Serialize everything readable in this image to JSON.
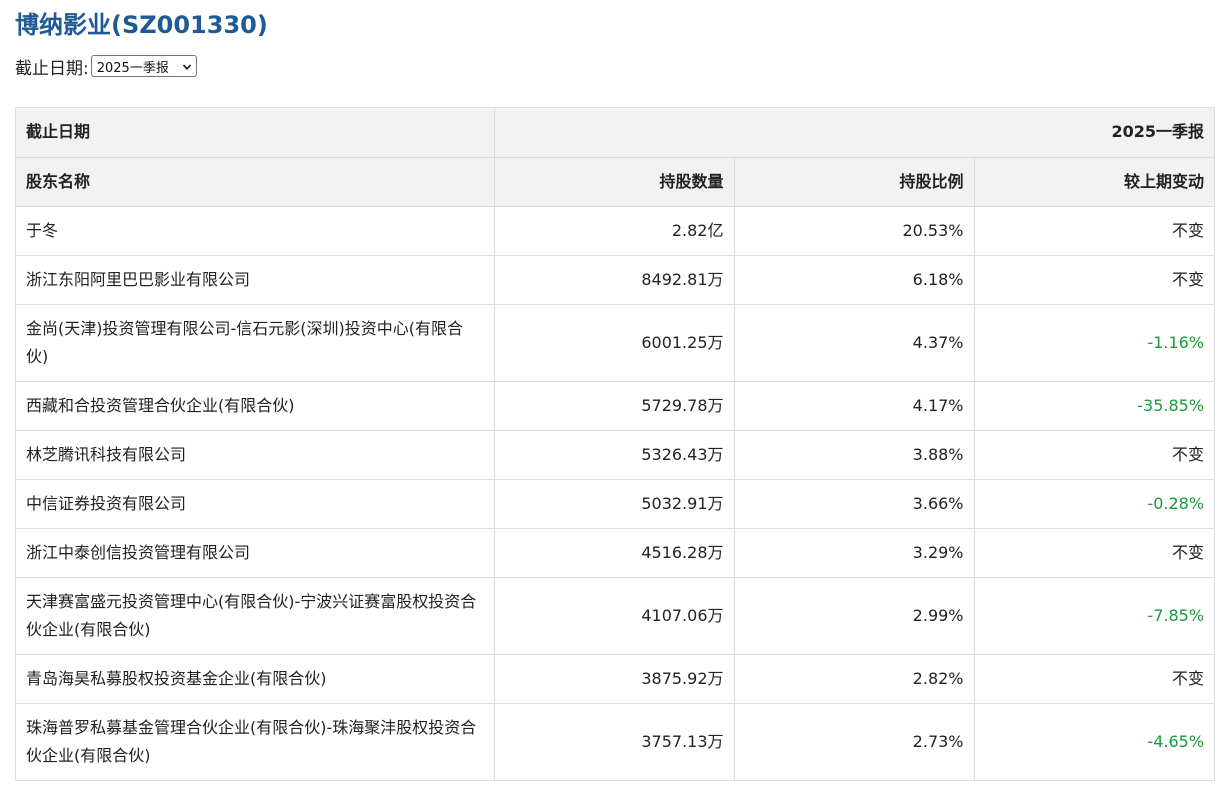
{
  "page": {
    "title": "博纳影业(SZ001330)"
  },
  "filter": {
    "label": "截止日期:",
    "selected": "2025一季报"
  },
  "table": {
    "date_header_label": "截止日期",
    "date_header_value": "2025一季报",
    "columns": [
      "股东名称",
      "持股数量",
      "持股比例",
      "较上期变动"
    ],
    "rows": [
      {
        "name": "于冬",
        "shares": "2.82亿",
        "ratio": "20.53%",
        "change": "不变"
      },
      {
        "name": "浙江东阳阿里巴巴影业有限公司",
        "shares": "8492.81万",
        "ratio": "6.18%",
        "change": "不变"
      },
      {
        "name": "金尚(天津)投资管理有限公司-信石元影(深圳)投资中心(有限合伙)",
        "shares": "6001.25万",
        "ratio": "4.37%",
        "change": "-1.16%"
      },
      {
        "name": "西藏和合投资管理合伙企业(有限合伙)",
        "shares": "5729.78万",
        "ratio": "4.17%",
        "change": "-35.85%"
      },
      {
        "name": "林芝腾讯科技有限公司",
        "shares": "5326.43万",
        "ratio": "3.88%",
        "change": "不变"
      },
      {
        "name": "中信证券投资有限公司",
        "shares": "5032.91万",
        "ratio": "3.66%",
        "change": "-0.28%"
      },
      {
        "name": "浙江中泰创信投资管理有限公司",
        "shares": "4516.28万",
        "ratio": "3.29%",
        "change": "不变"
      },
      {
        "name": "天津赛富盛元投资管理中心(有限合伙)-宁波兴证赛富股权投资合伙企业(有限合伙)",
        "shares": "4107.06万",
        "ratio": "2.99%",
        "change": "-7.85%"
      },
      {
        "name": "青岛海昊私募股权投资基金企业(有限合伙)",
        "shares": "3875.92万",
        "ratio": "2.82%",
        "change": "不变"
      },
      {
        "name": "珠海普罗私募基金管理合伙企业(有限合伙)-珠海聚沣股权投资合伙企业(有限合伙)",
        "shares": "3757.13万",
        "ratio": "2.73%",
        "change": "-4.65%"
      }
    ]
  },
  "colors": {
    "title": "#1f5a96",
    "negative_change": "#1a9a3a",
    "header_bg": "#f2f2f2",
    "border": "#dddddd"
  },
  "icons": {
    "dropdown": "chevron-down-icon"
  }
}
